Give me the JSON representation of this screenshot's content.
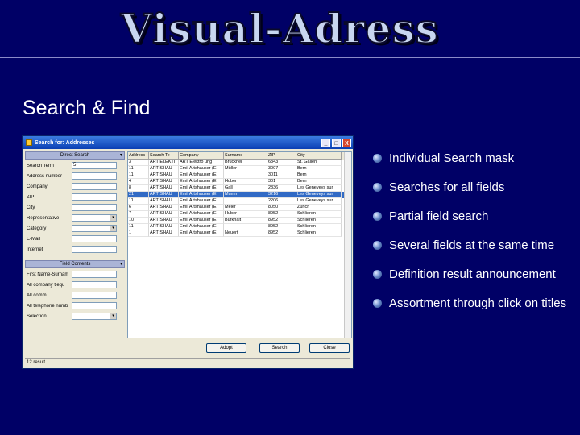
{
  "logo_text": "Visual-Adress",
  "slide_title": "Search & Find",
  "bullets": [
    "Individual Search mask",
    "Searches for all fields",
    "Partial field search",
    "Several fields at the same time",
    "Definition result announcement",
    "Assortment through click on titles"
  ],
  "window": {
    "title": "Search for: Addresses",
    "minimize": "_",
    "maximize": "□",
    "close": "X"
  },
  "panel1": {
    "header": "Direct Search",
    "fields": [
      {
        "label": "Search Term",
        "value": "5"
      },
      {
        "label": "Address number",
        "value": ""
      },
      {
        "label": "Company",
        "value": ""
      },
      {
        "label": "ZIP",
        "value": ""
      },
      {
        "label": "City",
        "value": ""
      },
      {
        "label": "Representative",
        "value": ""
      },
      {
        "label": "Category",
        "value": ""
      },
      {
        "label": "E-Mail",
        "value": ""
      },
      {
        "label": "Internet",
        "value": ""
      }
    ]
  },
  "panel2": {
    "header": "Field Contents",
    "fields": [
      {
        "label": "First Name-Surnam",
        "value": ""
      },
      {
        "label": "All company tiequ",
        "value": ""
      },
      {
        "label": "All comm.",
        "value": ""
      },
      {
        "label": "All telephone numb",
        "value": ""
      },
      {
        "label": "Selection",
        "value": ""
      }
    ]
  },
  "table": {
    "columns": [
      "Address",
      "Search Te",
      "Company",
      "Surname",
      "ZIP",
      "City"
    ],
    "rows": [
      [
        "3",
        "ART ELEKTI",
        "ART Elektro ung",
        "Bruckner",
        "6343",
        "St. Gallen"
      ],
      [
        "11",
        "ART SHAU",
        "Emil Artshauser (E",
        "Müller",
        "3007",
        "Bern"
      ],
      [
        "11",
        "ART SHAU",
        "Emil Artshauser (E",
        "",
        "3011",
        "Bern"
      ],
      [
        "4",
        "ART SHAU",
        "Emil Artshauser (E",
        "Huber",
        "301",
        "Bern"
      ],
      [
        "8",
        "ART SHAU",
        "Emil Artshauser (E",
        "Gall",
        "2336",
        "Les Geneveys sur"
      ],
      [
        "21",
        "ART SHAU",
        "Emil Artshauser (E",
        "Mumm",
        "3216",
        "Les Geneveys sur"
      ],
      [
        "11",
        "ART SHAU",
        "Emil Artshauser (E",
        "",
        "2206",
        "Les Geneveys sur"
      ],
      [
        "6",
        "ART SHAU",
        "Emil Artshauser (E",
        "Meier",
        "8050",
        "Zürich"
      ],
      [
        "7",
        "ART SHAU",
        "Emil Artshauser (E",
        "Huber",
        "8952",
        "Schlieren"
      ],
      [
        "10",
        "ART SHAU",
        "Emil Artshauser (E",
        "Burkhalt",
        "8952",
        "Schlieren"
      ],
      [
        "11",
        "ART SHAU",
        "Emil Artshauser (E",
        "",
        "8952",
        "Schlieren"
      ],
      [
        "1",
        "ART SHAU",
        "Emil Artshauser (E",
        "Neuert",
        "8952",
        "Schlieren"
      ]
    ],
    "selected_row_index": 5
  },
  "buttons": {
    "adopt": "Adopt",
    "search": "Search",
    "close": "Close"
  },
  "status": "12 result"
}
